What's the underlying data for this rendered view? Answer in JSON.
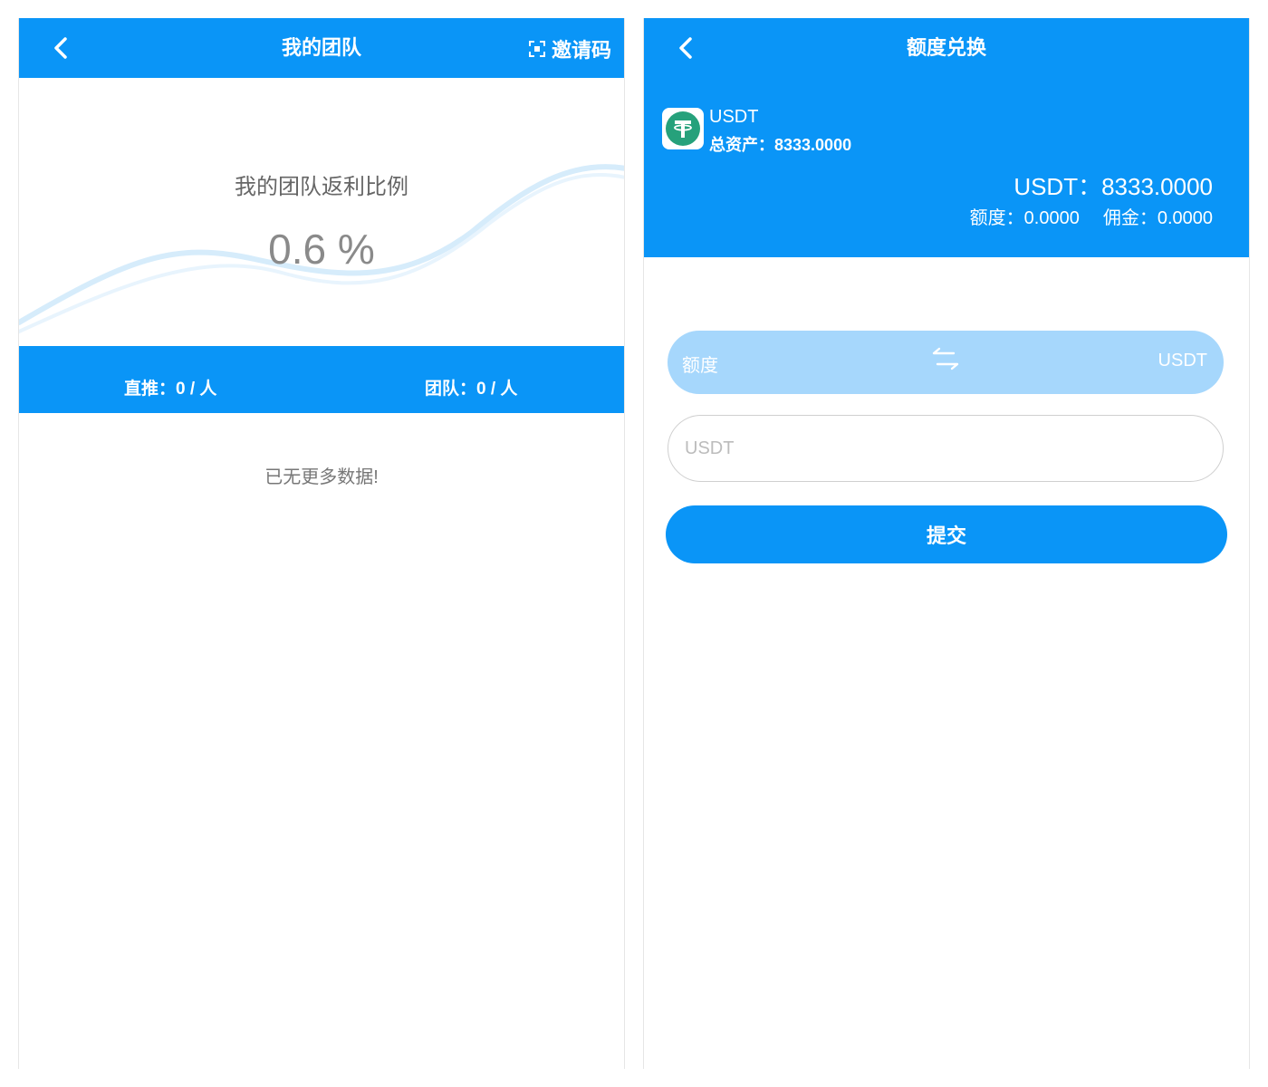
{
  "team_screen": {
    "title": "我的团队",
    "invite_label": "邀请码",
    "rebate_label": "我的团队返利比例",
    "rebate_value": "0.6 %",
    "direct_label": "直推：0 / 人",
    "team_label": "团队：0 / 人",
    "empty_message": "已无更多数据!"
  },
  "exchange_screen": {
    "title": "额度兑换",
    "coin_name": "USDT",
    "coin_total": "总资产：8333.0000",
    "usdt_balance": "USDT：8333.0000",
    "quota_balance": "额度：0.0000",
    "commission_balance": "佣金：0.0000",
    "swap_from": "额度",
    "swap_to": "USDT",
    "amount_placeholder": "USDT",
    "submit_label": "提交"
  },
  "colors": {
    "primary": "#0a95f7",
    "swap_bar": "#a6d7fc",
    "coin_green": "#26a17b"
  },
  "icons": [
    "back-arrow-icon",
    "scan-icon",
    "usdt-logo-icon",
    "swap-arrows-icon"
  ]
}
